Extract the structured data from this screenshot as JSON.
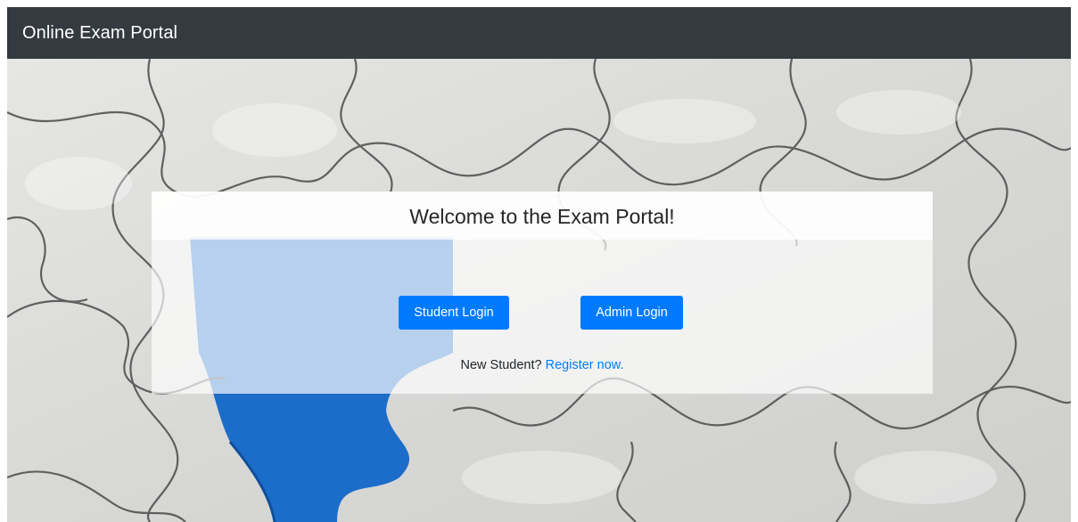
{
  "navbar": {
    "brand": "Online Exam Portal"
  },
  "card": {
    "title": "Welcome to the Exam Portal!",
    "student_login_label": "Student Login",
    "admin_login_label": "Admin Login",
    "register_prompt": "New Student?",
    "register_link": "Register now."
  },
  "colors": {
    "navbar": "#343a40",
    "primary": "#007bff",
    "missing_piece": "#1c6dc9"
  },
  "background": {
    "image": "jigsaw-puzzle-with-missing-piece"
  }
}
